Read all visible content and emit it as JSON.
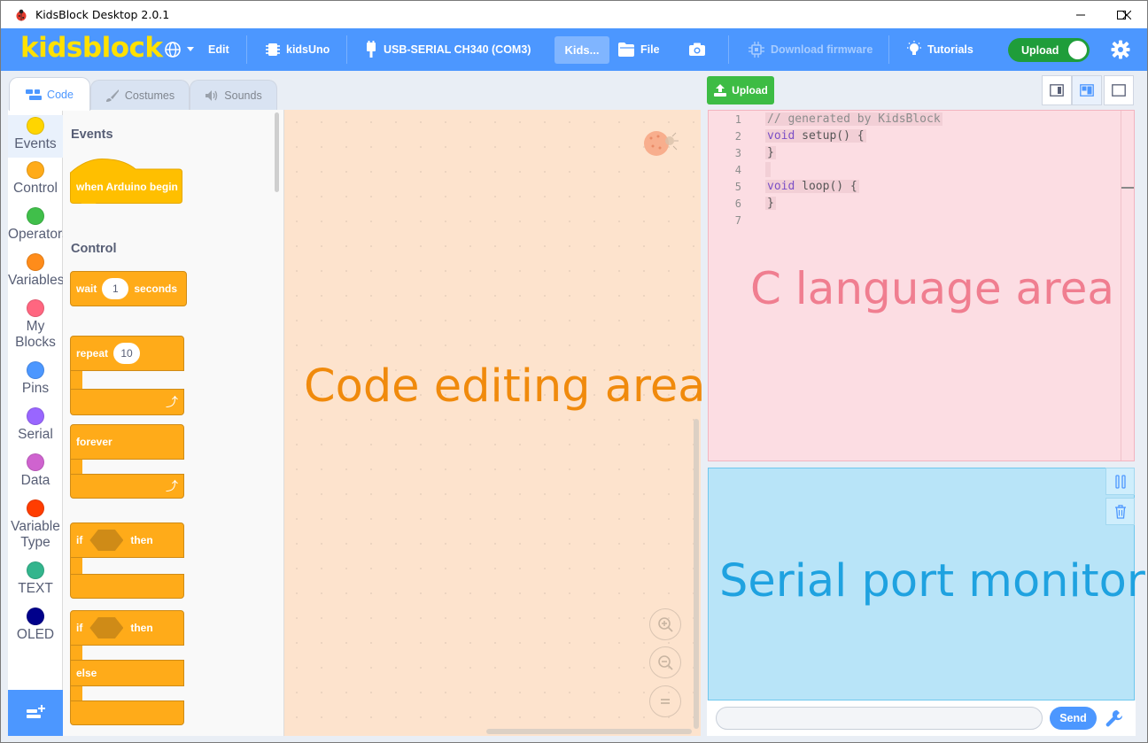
{
  "window": {
    "title": "KidsBlock Desktop 2.0.1"
  },
  "menubar": {
    "logo": "kidsblock",
    "edit": "Edit",
    "device": "kidsUno",
    "port": "USB-SERIAL CH340 (COM3)",
    "project": "Kids...",
    "file": "File",
    "download_firmware": "Download firmware",
    "tutorials": "Tutorials",
    "upload_toggle": "Upload"
  },
  "tabs": [
    {
      "label": "Code",
      "icon": "code-icon"
    },
    {
      "label": "Costumes",
      "icon": "brush-icon"
    },
    {
      "label": "Sounds",
      "icon": "speaker-icon"
    }
  ],
  "categories": [
    {
      "label": "Events",
      "color": "#ffd500"
    },
    {
      "label": "Control",
      "color": "#ffab19"
    },
    {
      "label": "Operators",
      "color": "#40bf4a"
    },
    {
      "label": "Variables",
      "color": "#ff8c1a"
    },
    {
      "label": "My Blocks",
      "color": "#ff6680"
    },
    {
      "label": "Pins",
      "color": "#4c97ff"
    },
    {
      "label": "Serial",
      "color": "#9966ff"
    },
    {
      "label": "Data",
      "color": "#cf63cf"
    },
    {
      "label": "Variable Type",
      "color": "#ff3d00"
    },
    {
      "label": "TEXT",
      "color": "#33b58d"
    },
    {
      "label": "OLED",
      "color": "#00008b"
    }
  ],
  "palette": {
    "events_heading": "Events",
    "when_begin": "when Arduino begin",
    "control_heading": "Control",
    "wait": "wait",
    "wait_value": "1",
    "seconds": "seconds",
    "repeat": "repeat",
    "repeat_value": "10",
    "forever": "forever",
    "if1": "if",
    "then1": "then",
    "if2": "if",
    "then2": "then",
    "else": "else"
  },
  "code_area": {
    "label": "Code editing area"
  },
  "right_panel": {
    "upload_button": "Upload",
    "c_code_lines": [
      {
        "n": "1",
        "text": "// generated by KidsBlock"
      },
      {
        "n": "2",
        "kw": "void",
        "text": " setup() {"
      },
      {
        "n": "3",
        "text": "}"
      },
      {
        "n": "4",
        "text": ""
      },
      {
        "n": "5",
        "kw": "void",
        "text": " loop() {"
      },
      {
        "n": "6",
        "text": "}"
      },
      {
        "n": "7",
        "text": ""
      }
    ],
    "c_label": "C language area",
    "serial_label": "Serial port monitor",
    "serial_input_value": "",
    "send_button": "Send"
  },
  "colors": {
    "menubar": "#4c97ff",
    "logo": "#ffe100",
    "upload_toggle": "#1f9d3a",
    "code_area_bg": "#fde3cd",
    "code_label": "#f08a0c",
    "c_area_bg": "#fcdde3",
    "c_label": "#f07e90",
    "serial_bg": "#b8e4f8",
    "serial_label": "#1fa2e0"
  }
}
